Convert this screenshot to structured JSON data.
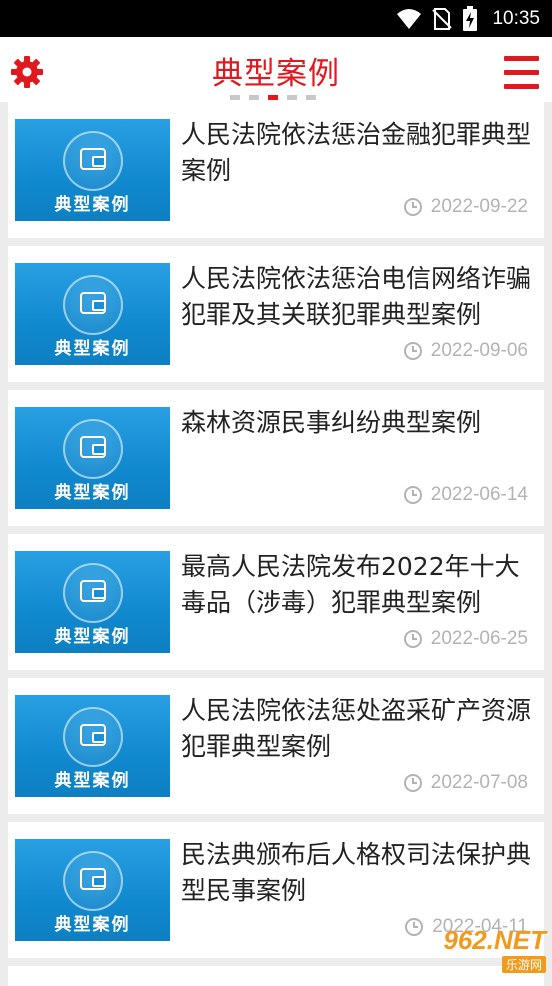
{
  "status_bar": {
    "time": "10:35",
    "icons": [
      "wifi-icon",
      "no-sim-icon",
      "battery-charging-icon"
    ]
  },
  "app_bar": {
    "title": "典型案例",
    "left_icon": "gear-icon",
    "right_icon": "hamburger-menu-icon",
    "page_indicator": {
      "count": 5,
      "active_index": 2
    }
  },
  "thumbnail_label": "典型案例",
  "cases": [
    {
      "title": "人民法院依法惩治金融犯罪典型案例",
      "date": "2022-09-22"
    },
    {
      "title": "人民法院依法惩治电信网络诈骗犯罪及其关联犯罪典型案例",
      "date": "2022-09-06"
    },
    {
      "title": "森林资源民事纠纷典型案例",
      "date": "2022-06-14"
    },
    {
      "title": "最高人民法院发布2022年十大毒品（涉毒）犯罪典型案例",
      "date": "2022-06-25"
    },
    {
      "title": "人民法院依法惩处盗采矿产资源犯罪典型案例",
      "date": "2022-07-08"
    },
    {
      "title": "民法典颁布后人格权司法保护典型民事案例",
      "date": "2022-04-11"
    }
  ],
  "watermark": {
    "main": "962.NET",
    "sub": "乐游网"
  },
  "colors": {
    "accent": "#e0191e",
    "date_gray": "#b3b3b3",
    "thumb_blue": "#1189cf"
  }
}
